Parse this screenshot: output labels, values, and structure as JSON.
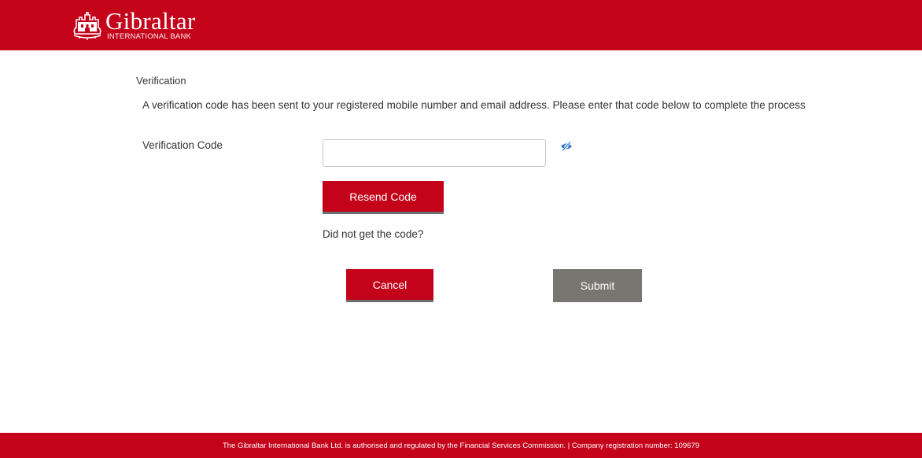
{
  "header": {
    "logo_name": "Gibraltar",
    "logo_subtitle": "INTERNATIONAL BANK",
    "brand_color": "#c4031b"
  },
  "verification": {
    "section_title": "Verification",
    "message": "A verification code has been sent to your registered mobile number and email address. Please enter that code below to complete the process",
    "code_label": "Verification Code",
    "code_value": "",
    "toggle_icon": "eye-slash-icon",
    "resend_label": "Resend Code",
    "help_text": "Did not get the code?"
  },
  "actions": {
    "cancel_label": "Cancel",
    "submit_label": "Submit",
    "submit_color": "#777670"
  },
  "footer": {
    "text": "The Gibraltar International Bank Ltd. is authorised and regulated by the Financial Services Commission. | Company registration number: 109679"
  }
}
